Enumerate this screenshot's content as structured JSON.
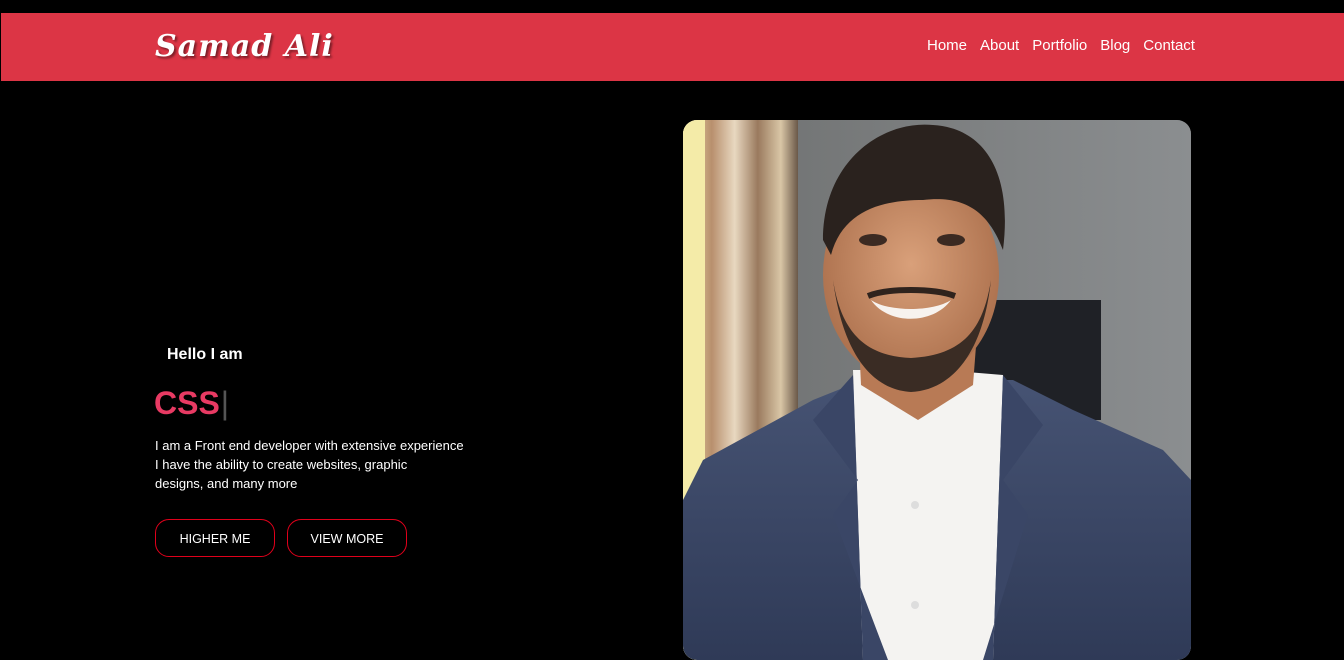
{
  "header": {
    "logo": "Samad Ali",
    "nav": [
      "Home",
      "About",
      "Portfolio",
      "Blog",
      "Contact"
    ],
    "background": "#dc3545"
  },
  "hero": {
    "greeting": "Hello I am",
    "typed_text": "CSS",
    "cursor": "|",
    "description": [
      "I am a Front end developer with extensive experience",
      "I have the ability to create websites, graphic",
      "designs, and many more"
    ],
    "buttons": {
      "primary": "HIGHER ME",
      "secondary": "VIEW MORE"
    },
    "accent": "#e83a63"
  },
  "portrait": {
    "icon": "portrait-photo"
  }
}
